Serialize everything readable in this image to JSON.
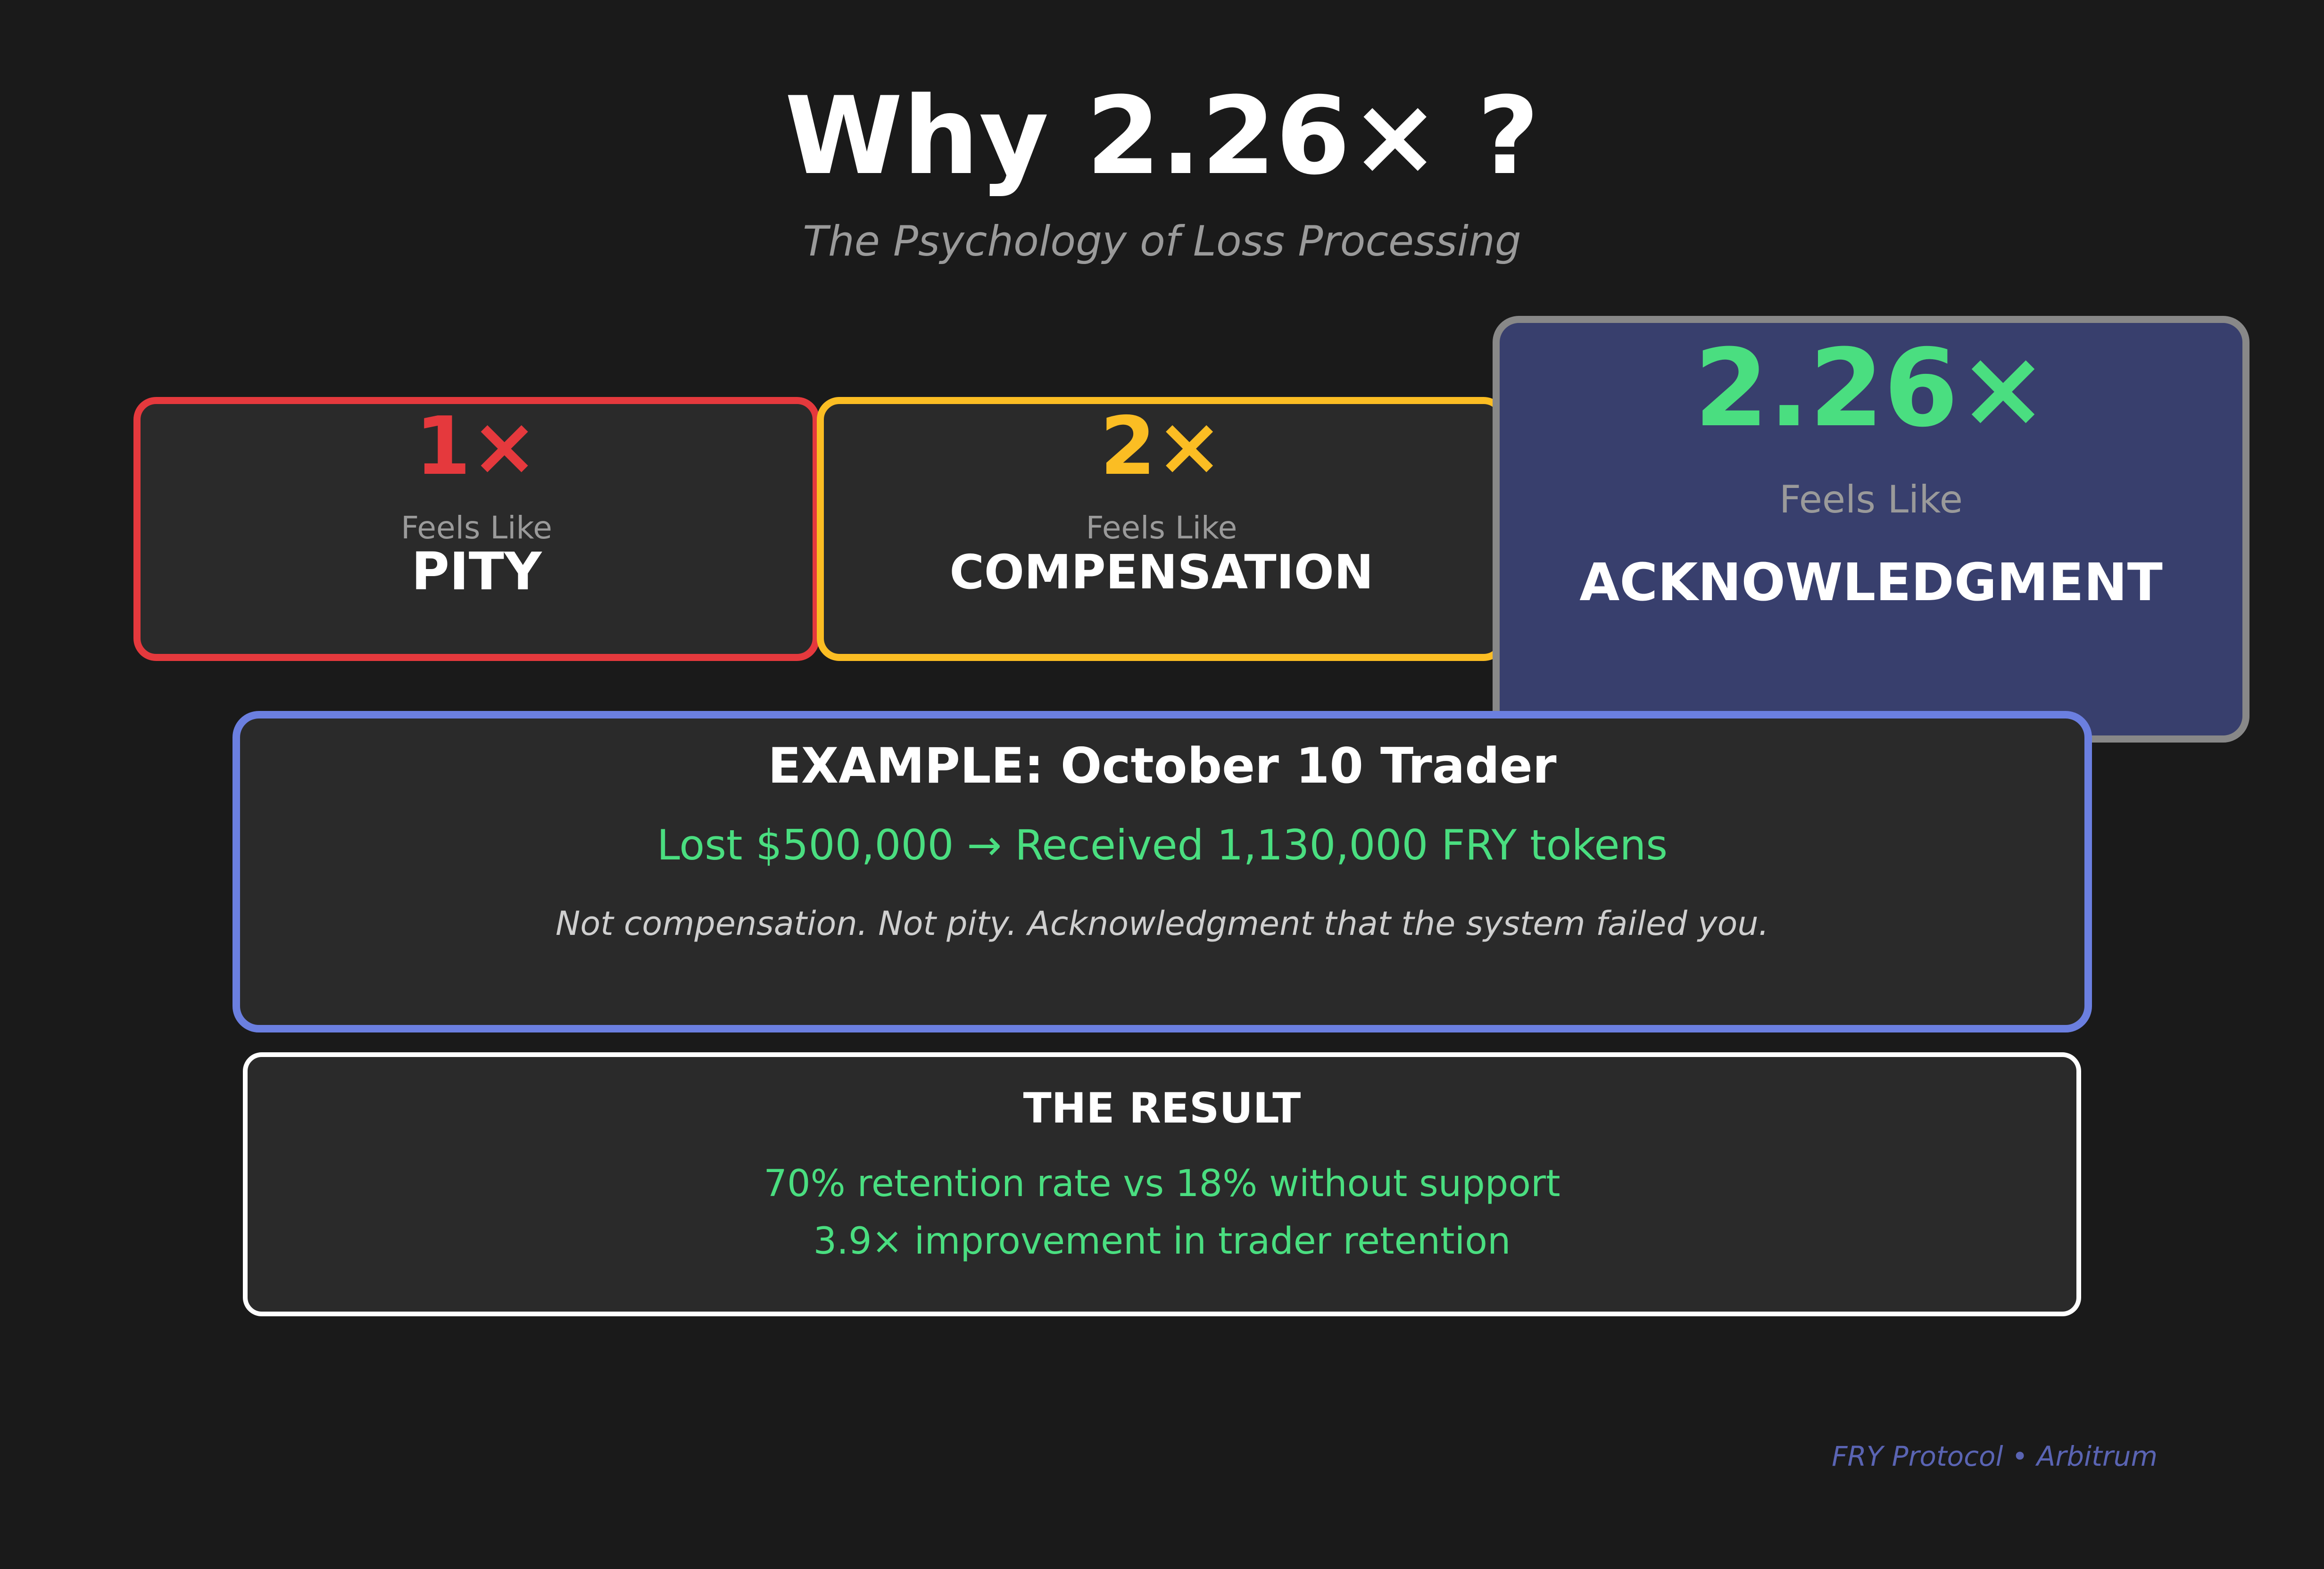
{
  "header": {
    "title": "Why 2.26× ?",
    "subtitle": "The Psychology of Loss Processing"
  },
  "cards": [
    {
      "multiplier": "1×",
      "feels_label": "Feels Like",
      "word": "PITY",
      "accent": "#e5393d"
    },
    {
      "multiplier": "2×",
      "feels_label": "Feels Like",
      "word": "COMPENSATION",
      "accent": "#fbbd23"
    },
    {
      "multiplier": "2.26×",
      "feels_label": "Feels Like",
      "word": "ACKNOWLEDGMENT",
      "accent": "#4ade80"
    }
  ],
  "example": {
    "title": "EXAMPLE: October 10 Trader",
    "line": "Lost $500,000 → Received 1,130,000 FRY tokens",
    "note": "Not compensation. Not pity. Acknowledgment that the system failed you."
  },
  "result": {
    "title": "THE RESULT",
    "lines": [
      "70% retention rate vs 18% without support",
      "3.9× improvement in trader retention"
    ]
  },
  "footer": "FRY Protocol • Arbitrum",
  "colors": {
    "background": "#1a1a1a",
    "card": "#2a2a2a",
    "highlight_card": "#383f6d",
    "example_border": "#6b7fe0",
    "green": "#4ade80",
    "red": "#e5393d",
    "yellow": "#fbbd23"
  }
}
